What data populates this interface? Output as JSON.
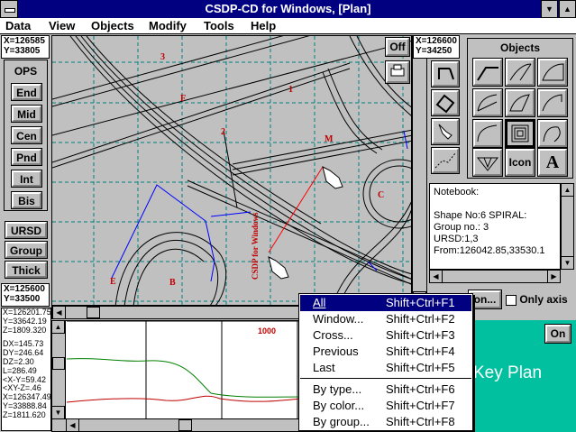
{
  "window": {
    "title": "CSDP-CD for Windows, [Plan]"
  },
  "menubar": [
    "Data",
    "View",
    "Objects",
    "Modify",
    "Tools",
    "Help"
  ],
  "coords": {
    "top_left": [
      "X=126585",
      "Y=33805"
    ],
    "top_right": [
      "X=126600",
      "Y=34250"
    ],
    "mid_left": [
      "X=125600",
      "Y=33500"
    ]
  },
  "left_toolbar": {
    "title": "OPS",
    "buttons": [
      "End",
      "Mid",
      "Cen",
      "Pnd",
      "Int",
      "Bis"
    ],
    "lower": [
      "URSD",
      "Group",
      "Thick"
    ]
  },
  "view_buttons": {
    "off": "Off"
  },
  "objects_panel": {
    "title": "Objects",
    "icon_label": "Icon",
    "text_label": "A"
  },
  "notebook": {
    "lines": [
      "Notebook:",
      "",
      "Shape No:6 SPIRAL:",
      "Group no.: 3",
      "URSD:1,3",
      "From:126042.85,33530.1"
    ]
  },
  "below_notebook": {
    "button_fragment": "on...",
    "only_axis": "Only axis"
  },
  "key_plan": {
    "label": "Key Plan",
    "on_button": "On"
  },
  "profile_readout": [
    "X=126201.75",
    "Y=33642.19",
    "Z=1809.320",
    "",
    "DX=145.73",
    "DY=246.64",
    "DZ=2.30",
    "L=286.49",
    "<X-Y=59.42",
    "<XY-Z=.46",
    "X=126347.49",
    "Y=33888.84",
    "Z=1811.620"
  ],
  "profile": {
    "tick_label": "1000"
  },
  "plan_labels": {
    "n1": "1",
    "n2": "2",
    "n3": "3",
    "M": "M",
    "C": "C",
    "E": "E",
    "B": "B",
    "F": "F",
    "stamp": "CSDP for Windows"
  },
  "context_menu": {
    "items": [
      {
        "label": "All",
        "key": "Shift+Ctrl+F1"
      },
      {
        "label": "Window...",
        "key": "Shift+Ctrl+F2"
      },
      {
        "label": "Cross...",
        "key": "Shift+Ctrl+F3"
      },
      {
        "label": "Previous",
        "key": "Shift+Ctrl+F4"
      },
      {
        "label": "Last",
        "key": "Shift+Ctrl+F5"
      },
      {
        "label": "By type...",
        "key": "Shift+Ctrl+F6"
      },
      {
        "label": "By color...",
        "key": "Shift+Ctrl+F7"
      },
      {
        "label": "By group...",
        "key": "Shift+Ctrl+F8"
      }
    ]
  },
  "colors": {
    "title": "#000080",
    "plan_bg": "#c0c0c0",
    "grid": "#008080",
    "key_plan": "#00c0a0",
    "menu_sel": "#000080"
  }
}
